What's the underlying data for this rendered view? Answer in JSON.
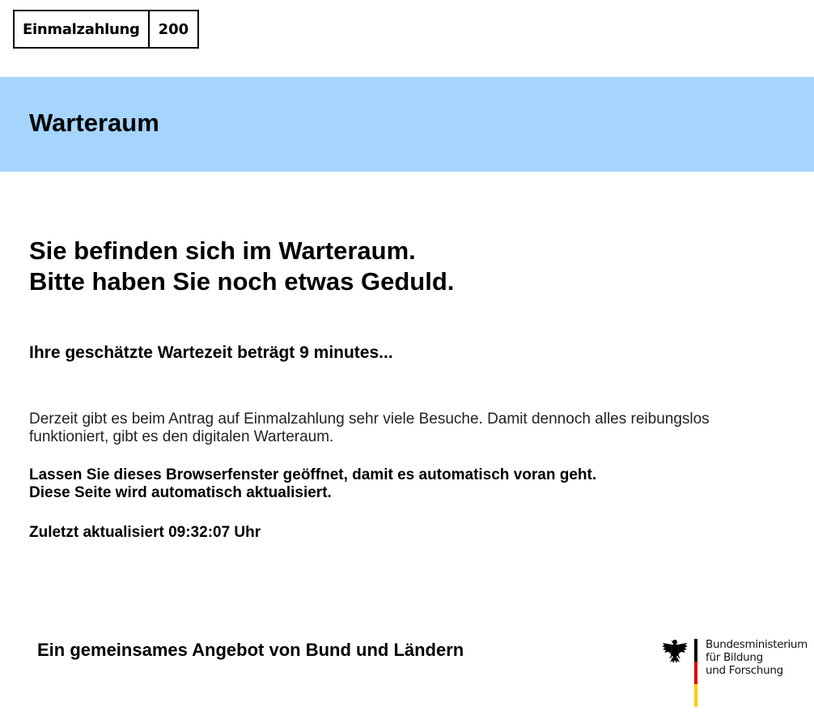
{
  "logo": {
    "name": "Einmalzahlung",
    "number": "200"
  },
  "banner": {
    "title": "Warteraum",
    "color": "#a5d4fd"
  },
  "main": {
    "headline_line1": "Sie befinden sich im Warteraum.",
    "headline_line2": "Bitte haben Sie noch etwas Geduld.",
    "wait_time": "Ihre geschätzte Wartezeit beträgt 9 minutes...",
    "info": "Derzeit gibt es beim Antrag auf Einmalzahlung sehr viele Besuche. Damit dennoch alles reibungslos funktioniert, gibt es den digitalen Warteraum.",
    "notice_line1": "Lassen Sie dieses Browserfenster geöffnet, damit es automatisch voran geht.",
    "notice_line2": "Diese Seite wird automatisch aktualisiert.",
    "updated": "Zuletzt aktualisiert 09:32:07 Uhr"
  },
  "footer": {
    "text": "Ein gemeinsames Angebot von Bund und Ländern",
    "ministry_line1": "Bundesministerium",
    "ministry_line2": "für Bildung",
    "ministry_line3": "und Forschung",
    "ministry_icon": "federal-eagle-icon",
    "flag_colors": [
      "#000000",
      "#dd0000",
      "#ffcc00"
    ]
  }
}
